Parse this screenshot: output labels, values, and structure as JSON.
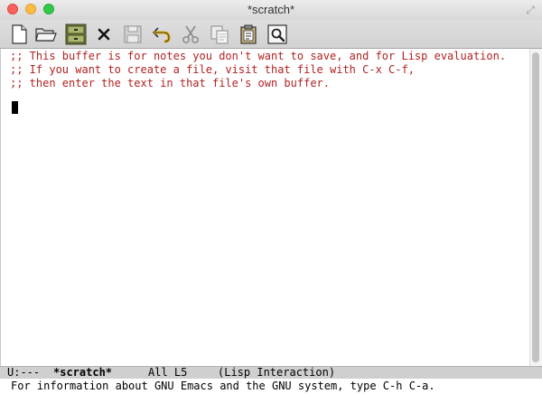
{
  "window": {
    "title": "*scratch*"
  },
  "toolbar": {
    "buttons": [
      {
        "name": "new-file",
        "icon": "new-document-icon"
      },
      {
        "name": "open-file",
        "icon": "folder-icon"
      },
      {
        "name": "dired",
        "icon": "file-cabinet-icon"
      },
      {
        "name": "kill-buffer",
        "icon": "close-x-icon"
      },
      {
        "name": "save",
        "icon": "floppy-disk-icon"
      },
      {
        "name": "undo",
        "icon": "undo-arrow-icon"
      },
      {
        "name": "cut",
        "icon": "scissors-icon"
      },
      {
        "name": "copy",
        "icon": "copy-icon"
      },
      {
        "name": "paste",
        "icon": "clipboard-icon"
      },
      {
        "name": "search",
        "icon": "magnifier-icon"
      }
    ]
  },
  "buffer": {
    "lines": [
      ";; This buffer is for notes you don't want to save, and for Lisp evaluation.",
      ";; If you want to create a file, visit that file with C-x C-f,",
      ";; then enter the text in that file's own buffer."
    ],
    "comment_color": "#b22222"
  },
  "modeline": {
    "status": "U:---",
    "buffer_name": "*scratch*",
    "position": "All L5",
    "mode": "(Lisp Interaction)"
  },
  "echo_area": {
    "message": "For information about GNU Emacs and the GNU system, type C-h C-a."
  }
}
